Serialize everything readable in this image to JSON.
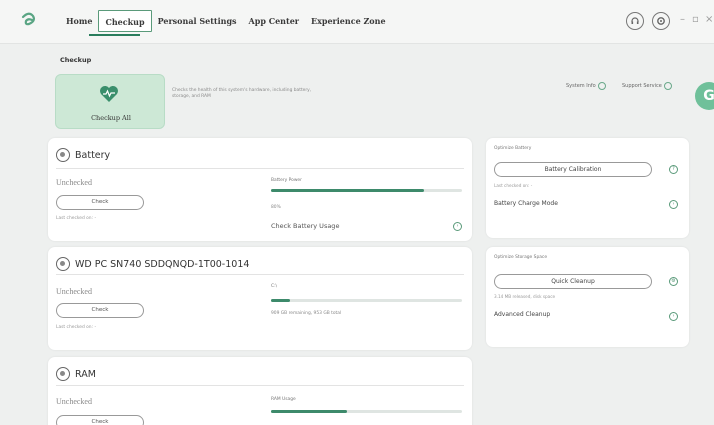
{
  "nav": {
    "tabs": [
      {
        "label": "Home"
      },
      {
        "label": "Checkup"
      },
      {
        "label": "Personal Settings"
      },
      {
        "label": "App Center"
      },
      {
        "label": "Experience Zone"
      }
    ]
  },
  "window_controls": {
    "minimize": "–",
    "restore": "▫",
    "close": "×"
  },
  "page": {
    "label": "Checkup",
    "checkup_all_label": "Checkup All",
    "description": "Checks the health of this system's hardware, including battery, storage, and RAM",
    "system_info": "System Info",
    "support_service": "Support Service",
    "fab_letter": "G"
  },
  "cards": {
    "battery": {
      "title": "Battery",
      "status": "Unchecked",
      "button": "Check",
      "last_checked": "Last checked on: -",
      "metric_label": "Battery Power",
      "fill": 0.8,
      "metric_sub": "80%",
      "usage_link": "Check Battery Usage"
    },
    "storage": {
      "title": "WD PC SN740 SDDQNQD-1T00-1014",
      "status": "Unchecked",
      "button": "Check",
      "last_checked": "Last checked on: -",
      "metric_label": "C:\\",
      "fill": 0.1,
      "metric_sub": "909 GB remaining, 953 GB total"
    },
    "ram": {
      "title": "RAM",
      "status": "Unchecked",
      "button": "Check",
      "metric_label": "RAM Usage",
      "fill": 0.4
    }
  },
  "side": {
    "battery": {
      "title": "Optimize Battery",
      "button": "Battery Calibration",
      "sub": "Last checked on: -",
      "link": "Battery Charge Mode"
    },
    "storage": {
      "title": "Optimize Storage Space",
      "button": "Quick Cleanup",
      "sub": "3.14 MB released, disk space",
      "link": "Advanced Cleanup"
    }
  },
  "colors": {
    "accent": "#2a7d5d",
    "bar": "#3d8a6b",
    "tile": "#cde8d6"
  }
}
